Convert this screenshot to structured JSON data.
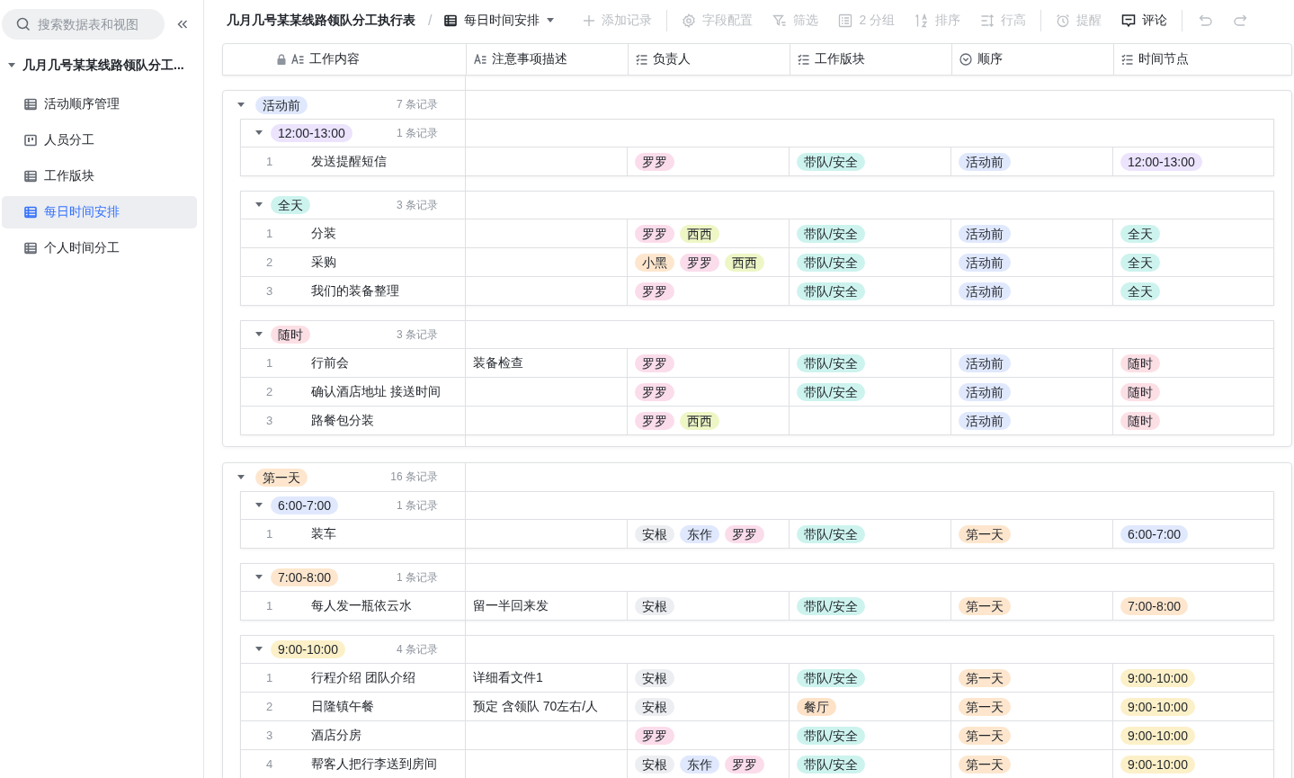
{
  "sidebar": {
    "search": {
      "placeholder": "搜索数据表和视图"
    },
    "base": {
      "title": "几月几号某某线路领队分工...",
      "expanded": true
    },
    "items": [
      {
        "label": "活动顺序管理",
        "kind": "grid",
        "selected": false
      },
      {
        "label": "人员分工",
        "kind": "kanban",
        "selected": false
      },
      {
        "label": "工作版块",
        "kind": "grid",
        "selected": false
      },
      {
        "label": "每日时间安排",
        "kind": "grid",
        "selected": true
      },
      {
        "label": "个人时间分工",
        "kind": "grid",
        "selected": false
      }
    ]
  },
  "toolbar": {
    "breadcrumb": "几月几号某某线路领队分工执行表",
    "separator": "/",
    "view": "每日时间安排",
    "actions": [
      {
        "label": "添加记录",
        "kind": "add",
        "disabled": true,
        "divider_before": false
      },
      {
        "label": "字段配置",
        "kind": "fields",
        "disabled": true,
        "divider_before": true
      },
      {
        "label": "筛选",
        "kind": "filter",
        "disabled": true,
        "divider_before": false
      },
      {
        "label": "2 分组",
        "kind": "group",
        "disabled": true,
        "divider_before": false
      },
      {
        "label": "排序",
        "kind": "sort",
        "disabled": true,
        "divider_before": false
      },
      {
        "label": "行高",
        "kind": "rowheight",
        "disabled": true,
        "divider_before": false
      },
      {
        "label": "提醒",
        "kind": "remind",
        "disabled": true,
        "divider_before": true
      },
      {
        "label": "评论",
        "kind": "comment",
        "disabled": false,
        "divider_before": false
      },
      {
        "kind": "undo",
        "disabled": true,
        "divider_before": true
      },
      {
        "kind": "redo",
        "disabled": true,
        "divider_before": false
      }
    ]
  },
  "columns": [
    {
      "label": "工作内容",
      "kind": "text",
      "locked": true
    },
    {
      "label": "注意事项描述",
      "kind": "text",
      "locked": false
    },
    {
      "label": "负责人",
      "kind": "multi",
      "locked": false
    },
    {
      "label": "工作版块",
      "kind": "multi",
      "locked": false
    },
    {
      "label": "顺序",
      "kind": "single",
      "locked": false
    },
    {
      "label": "时间节点",
      "kind": "multi",
      "locked": false
    }
  ],
  "groups": [
    {
      "tag": {
        "label": "活动前",
        "color": "#e0e8fd"
      },
      "count": "7 条记录",
      "expanded": true,
      "children": [
        {
          "tag": {
            "label": "12:00-13:00",
            "color": "#ece3fd"
          },
          "count": "1 条记录",
          "expanded": true,
          "rows": [
            {
              "number": "1",
              "title": "发送提醒短信",
              "note": "",
              "owners": [
                {
                  "label": "罗罗",
                  "color": "#fbdcea"
                }
              ],
              "block": [
                {
                  "label": "带队/安全",
                  "color": "#cdf3ee"
                }
              ],
              "order": [
                {
                  "label": "活动前",
                  "color": "#e0e8fd"
                }
              ],
              "time": [
                {
                  "label": "12:00-13:00",
                  "color": "#ece3fd"
                }
              ]
            }
          ]
        },
        {
          "tag": {
            "label": "全天",
            "color": "#cdf3ee"
          },
          "count": "3 条记录",
          "expanded": true,
          "rows": [
            {
              "number": "1",
              "title": "分装",
              "note": "",
              "owners": [
                {
                  "label": "罗罗",
                  "color": "#fbdcea"
                },
                {
                  "label": "西西",
                  "color": "#eef6c6"
                }
              ],
              "block": [
                {
                  "label": "带队/安全",
                  "color": "#cdf3ee"
                }
              ],
              "order": [
                {
                  "label": "活动前",
                  "color": "#e0e8fd"
                }
              ],
              "time": [
                {
                  "label": "全天",
                  "color": "#cdf3ee"
                }
              ]
            },
            {
              "number": "2",
              "title": "采购",
              "note": "",
              "owners": [
                {
                  "label": "小黑",
                  "color": "#fde6cd"
                },
                {
                  "label": "罗罗",
                  "color": "#fbdcea"
                },
                {
                  "label": "西西",
                  "color": "#eef6c6"
                }
              ],
              "block": [
                {
                  "label": "带队/安全",
                  "color": "#cdf3ee"
                }
              ],
              "order": [
                {
                  "label": "活动前",
                  "color": "#e0e8fd"
                }
              ],
              "time": [
                {
                  "label": "全天",
                  "color": "#cdf3ee"
                }
              ]
            },
            {
              "number": "3",
              "title": "我们的装备整理",
              "note": "",
              "owners": [
                {
                  "label": "罗罗",
                  "color": "#fbdcea"
                }
              ],
              "block": [
                {
                  "label": "带队/安全",
                  "color": "#cdf3ee"
                }
              ],
              "order": [
                {
                  "label": "活动前",
                  "color": "#e0e8fd"
                }
              ],
              "time": [
                {
                  "label": "全天",
                  "color": "#cdf3ee"
                }
              ]
            }
          ]
        },
        {
          "tag": {
            "label": "随时",
            "color": "#fcdfe5"
          },
          "count": "3 条记录",
          "expanded": true,
          "rows": [
            {
              "number": "1",
              "title": "行前会",
              "note": "装备检查",
              "owners": [
                {
                  "label": "罗罗",
                  "color": "#fbdcea"
                }
              ],
              "block": [
                {
                  "label": "带队/安全",
                  "color": "#cdf3ee"
                }
              ],
              "order": [
                {
                  "label": "活动前",
                  "color": "#e0e8fd"
                }
              ],
              "time": [
                {
                  "label": "随时",
                  "color": "#fcdfe5"
                }
              ]
            },
            {
              "number": "2",
              "title": "确认酒店地址 接送时间",
              "note": "",
              "owners": [
                {
                  "label": "罗罗",
                  "color": "#fbdcea"
                }
              ],
              "block": [
                {
                  "label": "带队/安全",
                  "color": "#cdf3ee"
                }
              ],
              "order": [
                {
                  "label": "活动前",
                  "color": "#e0e8fd"
                }
              ],
              "time": [
                {
                  "label": "随时",
                  "color": "#fcdfe5"
                }
              ]
            },
            {
              "number": "3",
              "title": "路餐包分装",
              "note": "",
              "owners": [
                {
                  "label": "罗罗",
                  "color": "#fbdcea"
                },
                {
                  "label": "西西",
                  "color": "#eef6c6"
                }
              ],
              "block": [],
              "order": [
                {
                  "label": "活动前",
                  "color": "#e0e8fd"
                }
              ],
              "time": [
                {
                  "label": "随时",
                  "color": "#fcdfe5"
                }
              ]
            }
          ]
        }
      ]
    },
    {
      "tag": {
        "label": "第一天",
        "color": "#fde6cd"
      },
      "count": "16 条记录",
      "expanded": true,
      "children": [
        {
          "tag": {
            "label": "6:00-7:00",
            "color": "#e0e8fd"
          },
          "count": "1 条记录",
          "expanded": true,
          "rows": [
            {
              "number": "1",
              "title": "装车",
              "note": "",
              "owners": [
                {
                  "label": "安根",
                  "color": "#eceef1"
                },
                {
                  "label": "东作",
                  "color": "#e0e8fd"
                },
                {
                  "label": "罗罗",
                  "color": "#fbdcea"
                }
              ],
              "block": [
                {
                  "label": "带队/安全",
                  "color": "#cdf3ee"
                }
              ],
              "order": [
                {
                  "label": "第一天",
                  "color": "#fde6cd"
                }
              ],
              "time": [
                {
                  "label": "6:00-7:00",
                  "color": "#e0e8fd"
                }
              ]
            }
          ]
        },
        {
          "tag": {
            "label": "7:00-8:00",
            "color": "#fde6cd"
          },
          "count": "1 条记录",
          "expanded": true,
          "rows": [
            {
              "number": "1",
              "title": "每人发一瓶依云水",
              "note": "留一半回来发",
              "owners": [
                {
                  "label": "安根",
                  "color": "#eceef1"
                }
              ],
              "block": [
                {
                  "label": "带队/安全",
                  "color": "#cdf3ee"
                }
              ],
              "order": [
                {
                  "label": "第一天",
                  "color": "#fde6cd"
                }
              ],
              "time": [
                {
                  "label": "7:00-8:00",
                  "color": "#fde6cd"
                }
              ]
            }
          ]
        },
        {
          "tag": {
            "label": "9:00-10:00",
            "color": "#fcf0c8"
          },
          "count": "4 条记录",
          "expanded": true,
          "rows": [
            {
              "number": "1",
              "title": "行程介绍 团队介绍",
              "note": "详细看文件1",
              "owners": [
                {
                  "label": "安根",
                  "color": "#eceef1"
                }
              ],
              "block": [
                {
                  "label": "带队/安全",
                  "color": "#cdf3ee"
                }
              ],
              "order": [
                {
                  "label": "第一天",
                  "color": "#fde6cd"
                }
              ],
              "time": [
                {
                  "label": "9:00-10:00",
                  "color": "#fcf0c8"
                }
              ]
            },
            {
              "number": "2",
              "title": "日隆镇午餐",
              "note": "预定 含领队 70左右/人",
              "owners": [
                {
                  "label": "安根",
                  "color": "#eceef1"
                }
              ],
              "block": [
                {
                  "label": "餐厅",
                  "color": "#fde2c8"
                }
              ],
              "order": [
                {
                  "label": "第一天",
                  "color": "#fde6cd"
                }
              ],
              "time": [
                {
                  "label": "9:00-10:00",
                  "color": "#fcf0c8"
                }
              ]
            },
            {
              "number": "3",
              "title": "酒店分房",
              "note": "",
              "owners": [
                {
                  "label": "罗罗",
                  "color": "#fbdcea"
                }
              ],
              "block": [
                {
                  "label": "带队/安全",
                  "color": "#cdf3ee"
                }
              ],
              "order": [
                {
                  "label": "第一天",
                  "color": "#fde6cd"
                }
              ],
              "time": [
                {
                  "label": "9:00-10:00",
                  "color": "#fcf0c8"
                }
              ]
            },
            {
              "number": "4",
              "title": "帮客人把行李送到房间",
              "note": "",
              "owners": [
                {
                  "label": "安根",
                  "color": "#eceef1"
                },
                {
                  "label": "东作",
                  "color": "#e0e8fd"
                },
                {
                  "label": "罗罗",
                  "color": "#fbdcea"
                }
              ],
              "block": [
                {
                  "label": "带队/安全",
                  "color": "#cdf3ee"
                }
              ],
              "order": [
                {
                  "label": "第一天",
                  "color": "#fde6cd"
                }
              ],
              "time": [
                {
                  "label": "9:00-10:00",
                  "color": "#fcf0c8"
                }
              ]
            }
          ]
        }
      ]
    }
  ]
}
